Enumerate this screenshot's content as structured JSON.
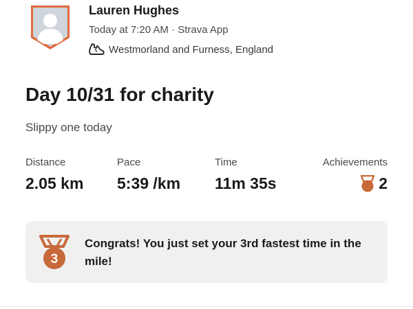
{
  "athlete": {
    "name": "Lauren Hughes",
    "meta": "Today at 7:20 AM · Strava App",
    "location": "Westmorland and Furness, England"
  },
  "activity": {
    "title": "Day 10/31 for charity",
    "description": "Slippy one today"
  },
  "stats": {
    "distance_label": "Distance",
    "distance_value": "2.05 km",
    "pace_label": "Pace",
    "pace_value": "5:39 /km",
    "time_label": "Time",
    "time_value": "11m 35s",
    "achievements_label": "Achievements",
    "achievements_value": "2"
  },
  "achievement_banner": {
    "medal_number": "3",
    "message": "Congrats! You just set your 3rd fastest time in the mile!"
  },
  "colors": {
    "medal": "#c8693a",
    "badge_border": "#e06b3c",
    "banner_bg": "#f0f0ef"
  },
  "icons": {
    "avatar": "avatar-shield",
    "shoe": "shoe-icon",
    "medal": "bronze-medal-icon"
  }
}
